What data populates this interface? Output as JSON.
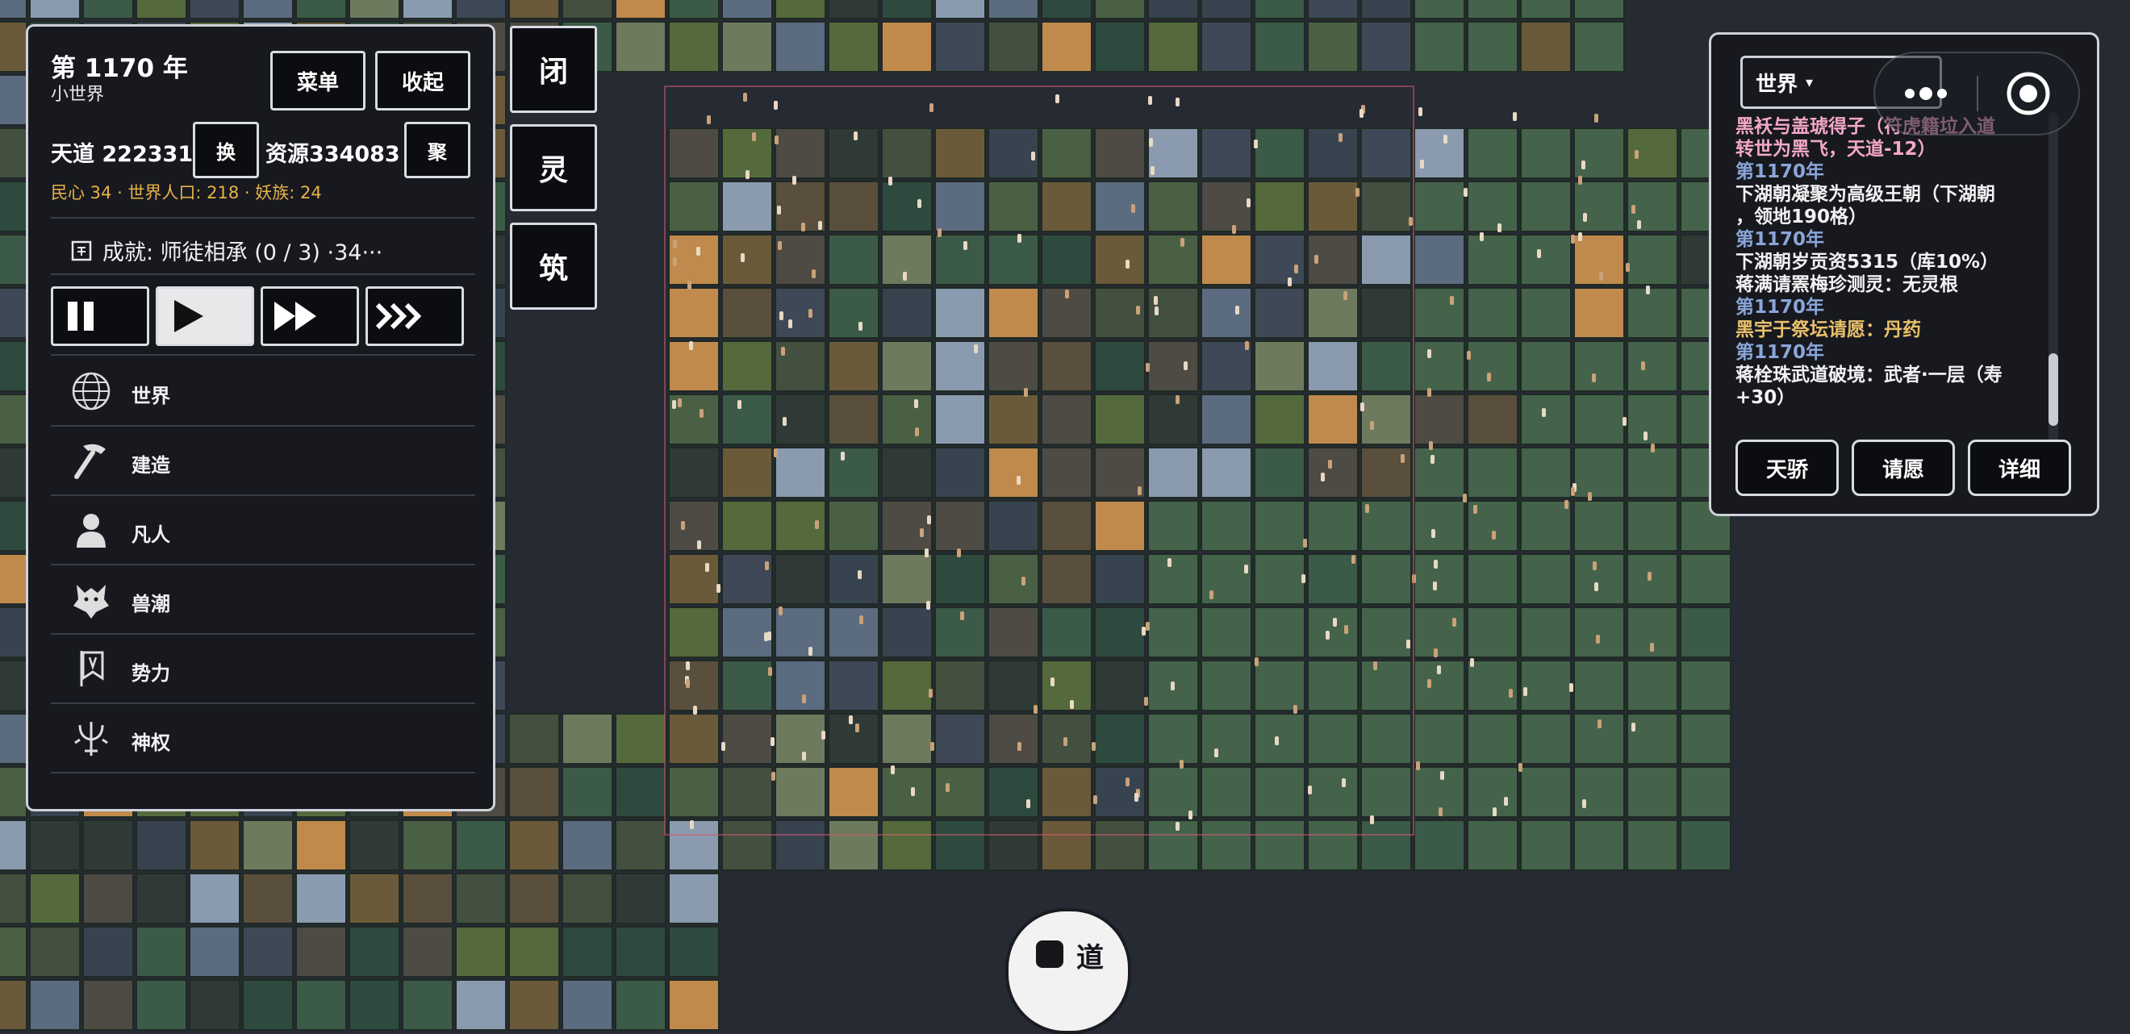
{
  "hud": {
    "year": "第 1170 年",
    "world_name": "小世界",
    "menu_label": "菜单",
    "collapse_label": "收起",
    "tiandao": "天道 222331",
    "swap_label": "换",
    "resources": "资源334083",
    "gather_label": "聚",
    "meta": "民心 34 · 世界人口: 218 · 妖族: 24",
    "achievement": "成就: 师徒相承 (0 / 3) ·34···"
  },
  "side_tabs": [
    {
      "label": "闭"
    },
    {
      "label": "灵"
    },
    {
      "label": "筑"
    }
  ],
  "speed": {
    "state": "play"
  },
  "menu": [
    {
      "label": "世界",
      "icon": "globe-icon"
    },
    {
      "label": "建造",
      "icon": "hammer-icon"
    },
    {
      "label": "凡人",
      "icon": "person-icon"
    },
    {
      "label": "兽潮",
      "icon": "wolf-icon"
    },
    {
      "label": "势力",
      "icon": "banner-icon"
    },
    {
      "label": "神权",
      "icon": "trident-icon"
    }
  ],
  "log_panel": {
    "dropdown": "世界",
    "dropdown_arrow": "▾",
    "lines": [
      {
        "text": "黑袄与盖琥得子（符虎籍垃入道",
        "style": "pink"
      },
      {
        "text": "转世为黑飞，天道-12）",
        "style": "pink"
      },
      {
        "text": "第1170年",
        "style": "year"
      },
      {
        "text": "下湖朝凝聚为高级王朝（下湖朝",
        "style": "white"
      },
      {
        "text": "，领地190格）",
        "style": "white"
      },
      {
        "text": "第1170年",
        "style": "year"
      },
      {
        "text": "下湖朝岁贡资5315（库10%）",
        "style": "white"
      },
      {
        "text": "蒋满请罴梅珍测灵：无灵根",
        "style": "white"
      },
      {
        "text": "第1170年",
        "style": "year"
      },
      {
        "text": "黑宇于祭坛请愿：丹药",
        "style": "gold"
      },
      {
        "text": "第1170年",
        "style": "year"
      },
      {
        "text": "蒋栓珠武道破境：武者·一层（寿",
        "style": "white"
      },
      {
        "text": "+30）",
        "style": "white"
      }
    ],
    "buttons": [
      "天骄",
      "请愿",
      "详细"
    ]
  },
  "bottom": {
    "label": "道"
  },
  "colors": {
    "background": "#262a33",
    "panel": "#17191f",
    "meta_text": "#e8b24a",
    "log_year": "#8aa5d8",
    "log_pink": "#f4a7c7",
    "log_gold": "#e9c06b"
  }
}
